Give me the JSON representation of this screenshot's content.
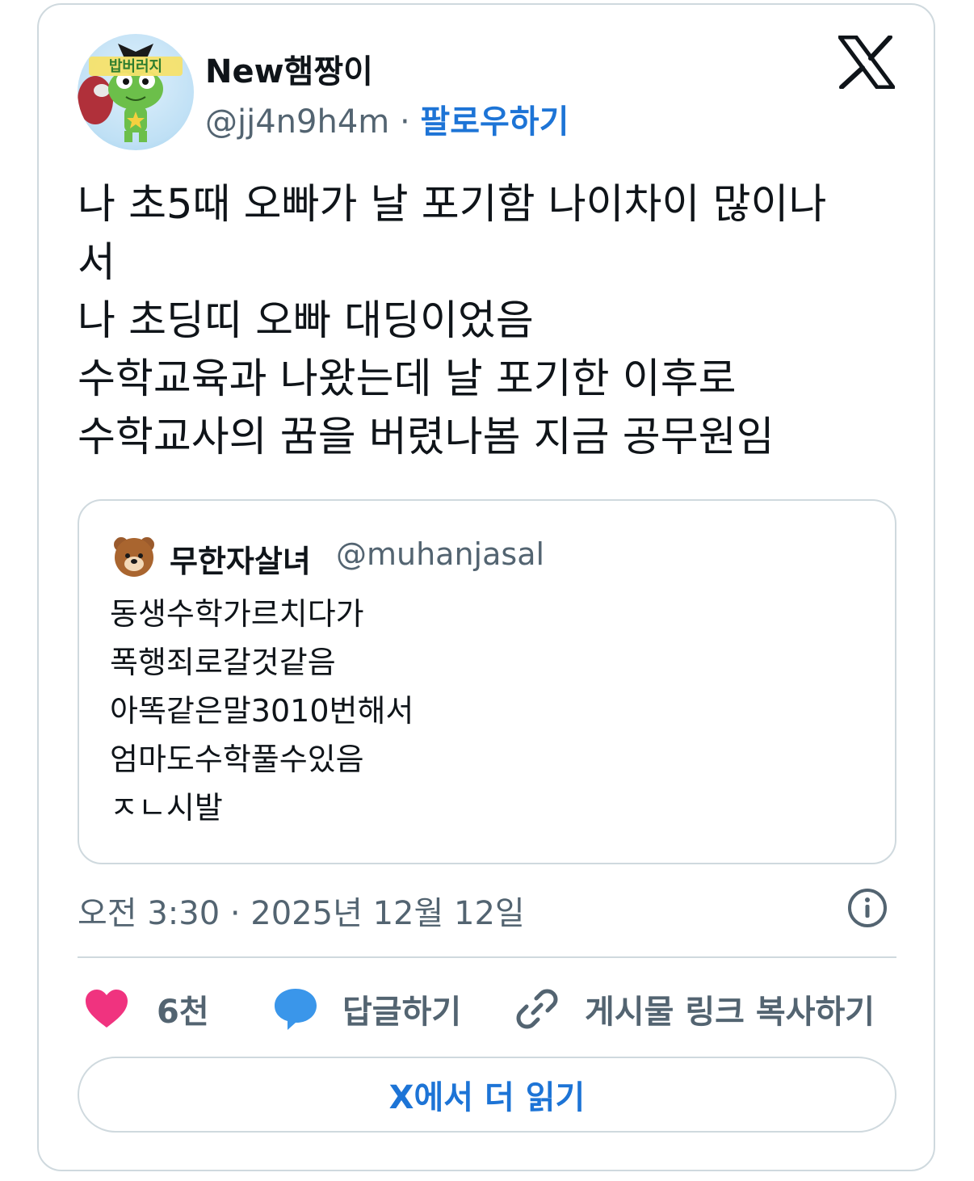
{
  "author": {
    "display_name": "New햄짱이",
    "handle": "@jj4n9h4m",
    "separator": "·",
    "follow_label": "팔로우하기",
    "avatar_text": "밥버러지"
  },
  "tweet": {
    "lines": [
      "나 초5때 오빠가 날 포기함 나이차이 많이나",
      "서",
      "나 초딩띠 오빠 대딩이었음",
      "수학교육과 나왔는데 날 포기한 이후로",
      "수학교사의 꿈을 버렸나봄 지금 공무원임"
    ]
  },
  "quote": {
    "display_name": "무한자살녀",
    "handle": "@muhanjasal",
    "lines": [
      "동생수학가르치다가",
      "폭행죄로갈것같음",
      "아똑같은말3010번해서",
      "엄마도수학풀수있음",
      "ㅈㄴ시발"
    ]
  },
  "timestamp": "오전 3:30 · 2025년 12월 12일",
  "actions": {
    "like_count": "6천",
    "reply_label": "답글하기",
    "copy_link_label": "게시물 링크 복사하기"
  },
  "read_more_label": "X에서 더 읽기",
  "colors": {
    "accent": "#1d74d6",
    "like": "#f0337f",
    "reply": "#3a96ea",
    "muted": "#536471",
    "border": "#cfd9de"
  },
  "icons": [
    "x-logo-icon",
    "info-icon",
    "heart-icon",
    "speech-bubble-icon",
    "link-icon"
  ]
}
